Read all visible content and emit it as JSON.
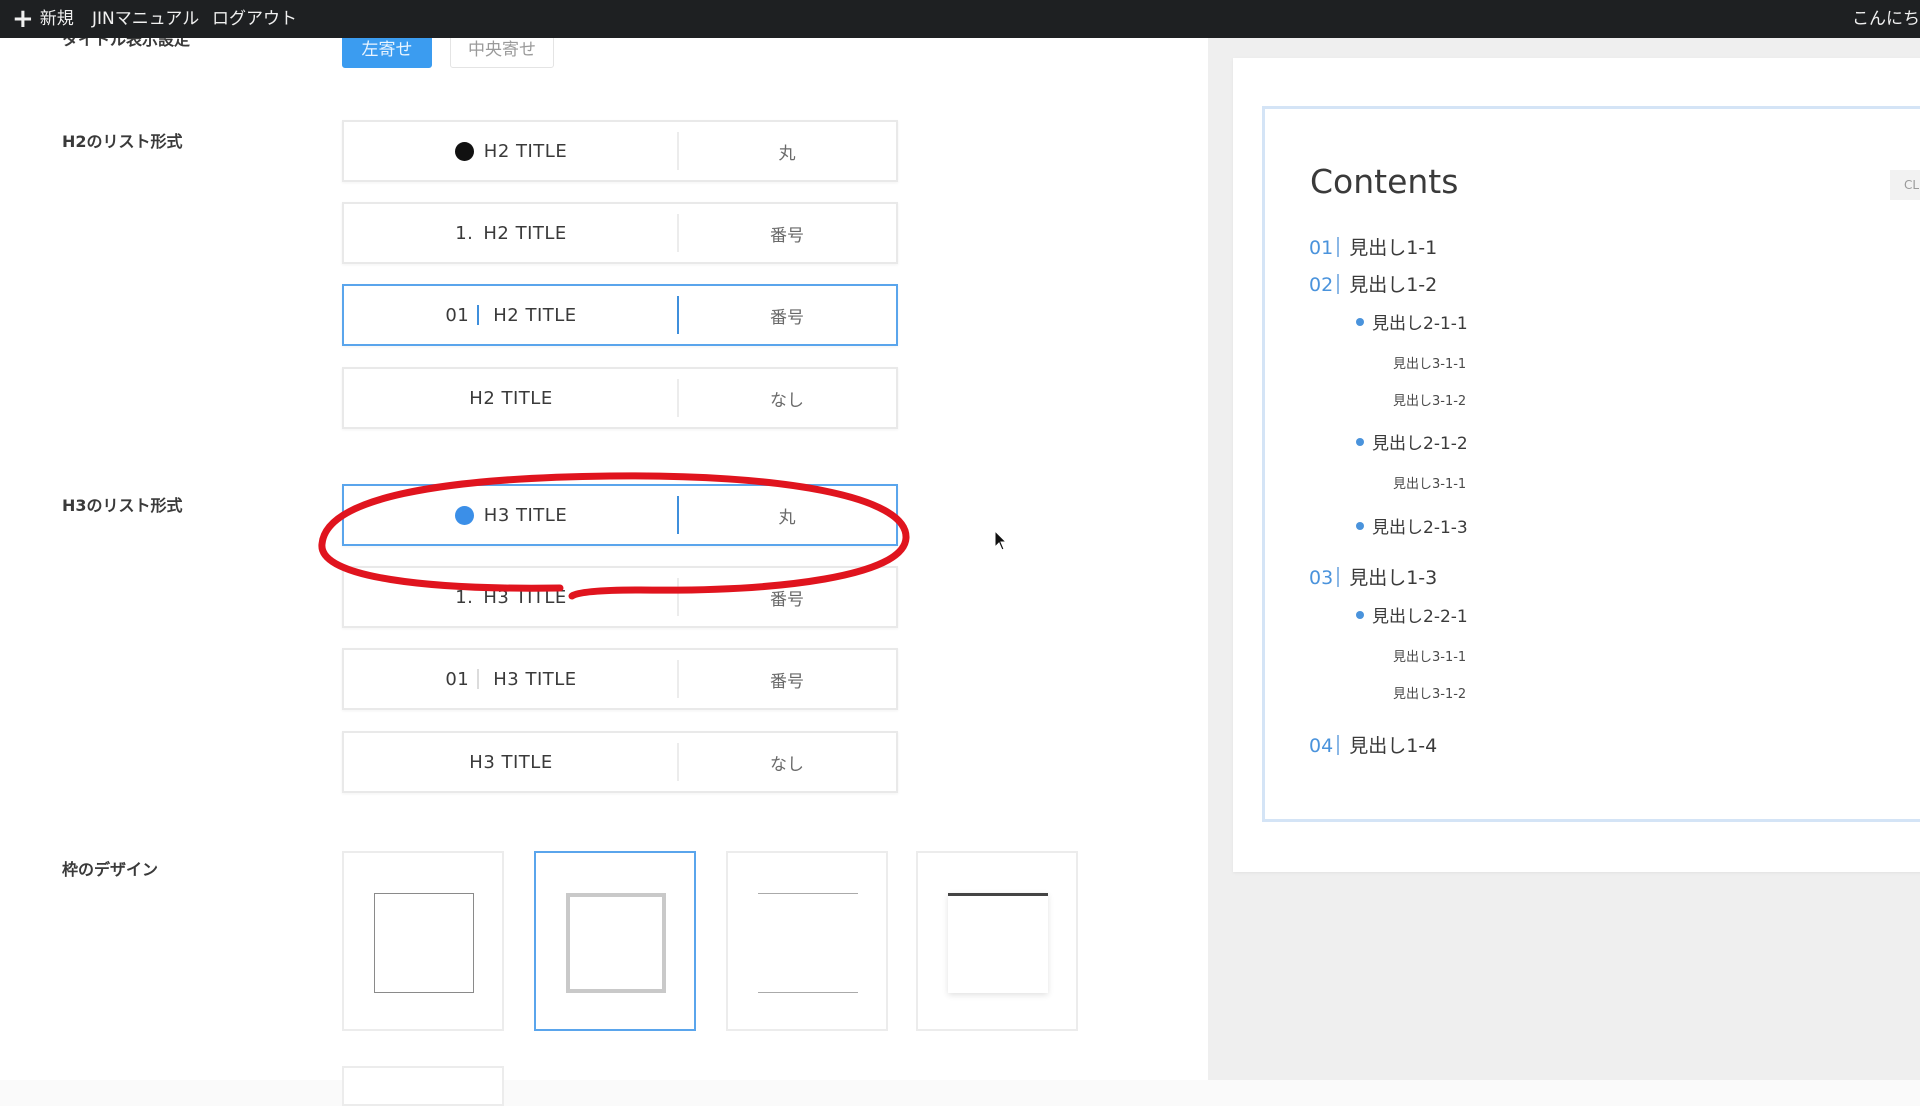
{
  "adminbar": {
    "new_label": "新規",
    "manual_label": "JINマニュアル",
    "logout_label": "ログアウト",
    "greeting": "こんにち"
  },
  "settings": {
    "title_align": {
      "label": "タイトル表示設定",
      "left_label": "左寄せ",
      "center_label": "中央寄せ",
      "selected": "left"
    },
    "h2": {
      "label": "H2のリスト形式",
      "options": [
        {
          "preview": "H2 TITLE",
          "type": "丸",
          "dot_color": "#111111"
        },
        {
          "prefix": "1.",
          "preview": "H2 TITLE",
          "type": "番号"
        },
        {
          "prefix": "01",
          "preview": "H2 TITLE",
          "type": "番号",
          "selected": true
        },
        {
          "preview": "H2 TITLE",
          "type": "なし"
        }
      ]
    },
    "h3": {
      "label": "H3のリスト形式",
      "options": [
        {
          "preview": "H3 TITLE",
          "type": "丸",
          "dot_color": "#3b8fe8",
          "selected": true
        },
        {
          "prefix": "1.",
          "preview": "H3 TITLE",
          "type": "番号"
        },
        {
          "prefix": "01",
          "preview": "H3 TITLE",
          "type": "番号"
        },
        {
          "preview": "H3 TITLE",
          "type": "なし"
        }
      ]
    },
    "frame": {
      "label": "枠のデザイン",
      "selected_index": 1
    }
  },
  "annotation": {
    "color": "#e0141e"
  },
  "toc": {
    "title": "Contents",
    "close_label": "CL",
    "accent": "#4a93dc",
    "items": [
      {
        "num": "01",
        "text": "見出し1-1"
      },
      {
        "num": "02",
        "text": "見出し1-2"
      },
      {
        "text": "見出し2-1-1"
      },
      {
        "text": "見出し3-1-1"
      },
      {
        "text": "見出し3-1-2"
      },
      {
        "text": "見出し2-1-2"
      },
      {
        "text": "見出し3-1-1"
      },
      {
        "text": "見出し2-1-3"
      },
      {
        "num": "03",
        "text": "見出し1-3"
      },
      {
        "text": "見出し2-2-1"
      },
      {
        "text": "見出し3-1-1"
      },
      {
        "text": "見出し3-1-2"
      },
      {
        "num": "04",
        "text": "見出し1-4"
      }
    ]
  }
}
